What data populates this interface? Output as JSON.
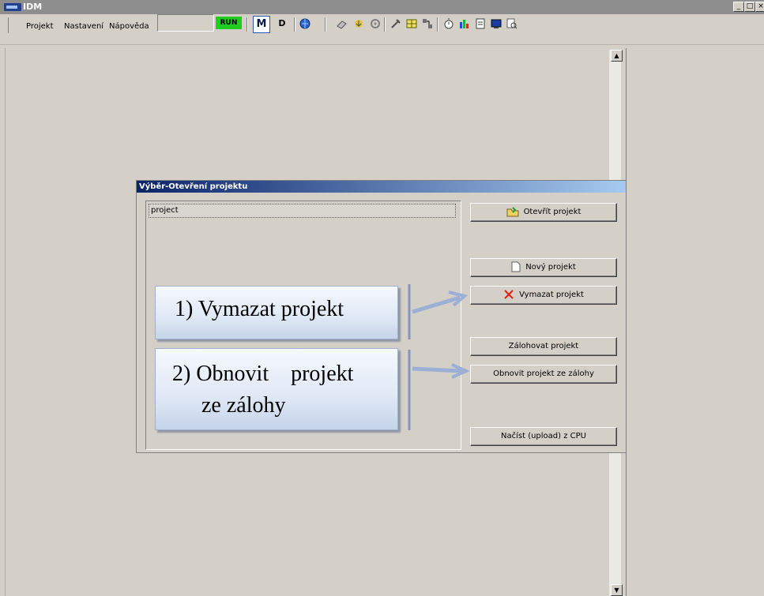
{
  "window": {
    "title": "IDM",
    "min_label": "_",
    "max_label": "□",
    "close_label": "×"
  },
  "menu": {
    "items": [
      "Projekt",
      "Nastavení",
      "Nápověda"
    ]
  },
  "toolbar": {
    "run_label": "RUN",
    "mode_m": "M",
    "mode_d": "D"
  },
  "colors": {
    "run_badge": "#1fcc1f",
    "title_gradient_start": "#0a246a",
    "title_gradient_end": "#a6caf0"
  },
  "dialog": {
    "title": "Výběr-Otevření projektu",
    "list_item": "project",
    "buttons": {
      "open": "Otevřít projekt",
      "new": "Nový projekt",
      "delete": "Vymazat projekt",
      "backup": "Zálohovat projekt",
      "restore": "Obnovit projekt ze zálohy",
      "upload": "Načíst (upload) z CPU"
    }
  },
  "callouts": {
    "first": "1) Vymazat projekt",
    "second_line1": "2) Obnovit    projekt",
    "second_line2": "ze zálohy"
  }
}
